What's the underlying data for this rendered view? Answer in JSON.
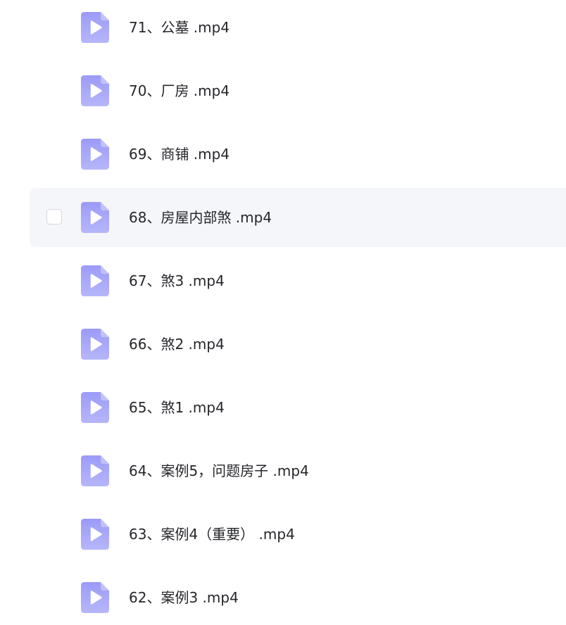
{
  "files": [
    {
      "name": "71、公墓 .mp4",
      "icon": "video-file-icon"
    },
    {
      "name": "70、厂房 .mp4",
      "icon": "video-file-icon"
    },
    {
      "name": "69、商铺 .mp4",
      "icon": "video-file-icon"
    },
    {
      "name": "68、房屋内部煞 .mp4",
      "icon": "video-file-icon",
      "hovered": true
    },
    {
      "name": "67、煞3 .mp4",
      "icon": "video-file-icon"
    },
    {
      "name": "66、煞2 .mp4",
      "icon": "video-file-icon"
    },
    {
      "name": "65、煞1 .mp4",
      "icon": "video-file-icon"
    },
    {
      "name": "64、案例5，问题房子 .mp4",
      "icon": "video-file-icon"
    },
    {
      "name": "63、案例4（重要） .mp4",
      "icon": "video-file-icon"
    },
    {
      "name": "62、案例3 .mp4",
      "icon": "video-file-icon"
    }
  ],
  "colors": {
    "icon_top": "#9b9bf7",
    "icon_bottom": "#b6b6fb",
    "row_hover_bg": "#f5f6f9",
    "text": "#25262b"
  }
}
